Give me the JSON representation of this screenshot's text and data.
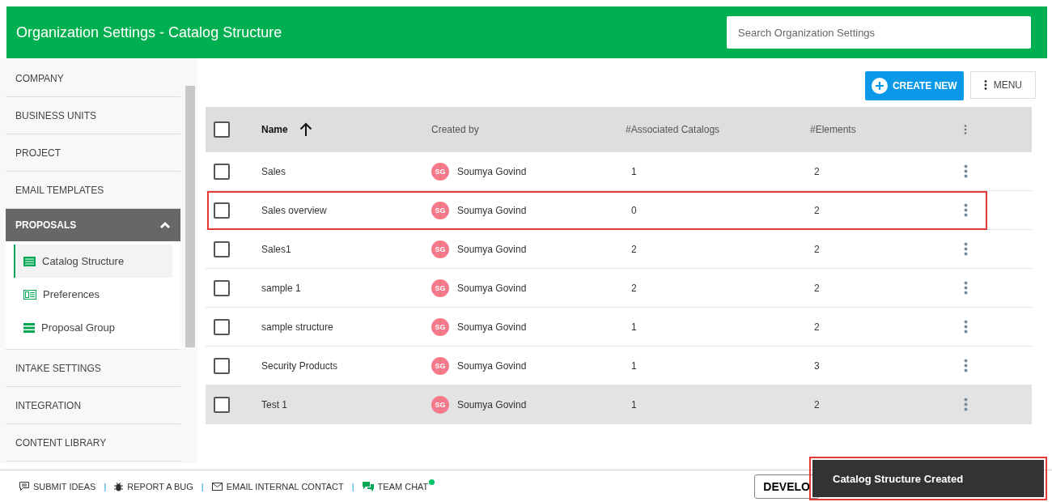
{
  "header": {
    "title": "Organization Settings - Catalog Structure",
    "search": {
      "placeholder": "Search Organization Settings"
    }
  },
  "sidebar": {
    "items": [
      {
        "label": "COMPANY",
        "expanded": false
      },
      {
        "label": "BUSINESS UNITS",
        "expanded": false
      },
      {
        "label": "PROJECT",
        "expanded": false
      },
      {
        "label": "EMAIL TEMPLATES",
        "expanded": false
      },
      {
        "label": "PROPOSALS",
        "expanded": true,
        "children": [
          {
            "label": "Catalog Structure",
            "selected": true,
            "kind": "list"
          },
          {
            "label": "Preferences",
            "selected": false,
            "kind": "card"
          },
          {
            "label": "Proposal Group",
            "selected": false,
            "kind": "stack"
          }
        ]
      },
      {
        "label": "INTAKE SETTINGS",
        "expanded": false
      },
      {
        "label": "INTEGRATION",
        "expanded": false
      },
      {
        "label": "CONTENT LIBRARY",
        "expanded": false
      }
    ]
  },
  "toolbar": {
    "create_button": "CREATE NEW",
    "menu_button": "MENU"
  },
  "table": {
    "select_all_checked": false,
    "columns": [
      "Name",
      "Created by",
      "#Associated Catalogs",
      "#Elements"
    ],
    "rows": [
      {
        "name": "Sales",
        "initials": "SG",
        "created_by": "Soumya Govind",
        "catalogs": "1",
        "elements": "2",
        "checked": false,
        "highlighted": false,
        "hovered": false
      },
      {
        "name": "Sales overview",
        "initials": "SG",
        "created_by": "Soumya Govind",
        "catalogs": "0",
        "elements": "2",
        "checked": false,
        "highlighted": true,
        "hovered": false
      },
      {
        "name": "Sales1",
        "initials": "SG",
        "created_by": "Soumya Govind",
        "catalogs": "2",
        "elements": "2",
        "checked": false,
        "highlighted": false,
        "hovered": false
      },
      {
        "name": "sample 1",
        "initials": "SG",
        "created_by": "Soumya Govind",
        "catalogs": "2",
        "elements": "2",
        "checked": false,
        "highlighted": false,
        "hovered": false
      },
      {
        "name": "sample structure",
        "initials": "SG",
        "created_by": "Soumya Govind",
        "catalogs": "1",
        "elements": "2",
        "checked": false,
        "highlighted": false,
        "hovered": false
      },
      {
        "name": "Security Products",
        "initials": "SG",
        "created_by": "Soumya Govind",
        "catalogs": "1",
        "elements": "3",
        "checked": false,
        "highlighted": false,
        "hovered": false
      },
      {
        "name": "Test 1",
        "initials": "SG",
        "created_by": "Soumya Govind",
        "catalogs": "1",
        "elements": "2",
        "checked": false,
        "highlighted": false,
        "hovered": true
      }
    ]
  },
  "footer": {
    "links": [
      {
        "label": "SUBMIT IDEAS",
        "kind": "ideas"
      },
      {
        "label": "REPORT A BUG",
        "kind": "bug",
        "separator": "|"
      },
      {
        "label": "EMAIL INTERNAL CONTACT",
        "kind": "mail",
        "separator": "|"
      },
      {
        "label": "TEAM CHAT",
        "kind": "chat",
        "online": true,
        "separator": "|"
      }
    ],
    "env_button": "DEVELO"
  },
  "toast": {
    "message": "Catalog Structure Created",
    "highlighted": true
  }
}
